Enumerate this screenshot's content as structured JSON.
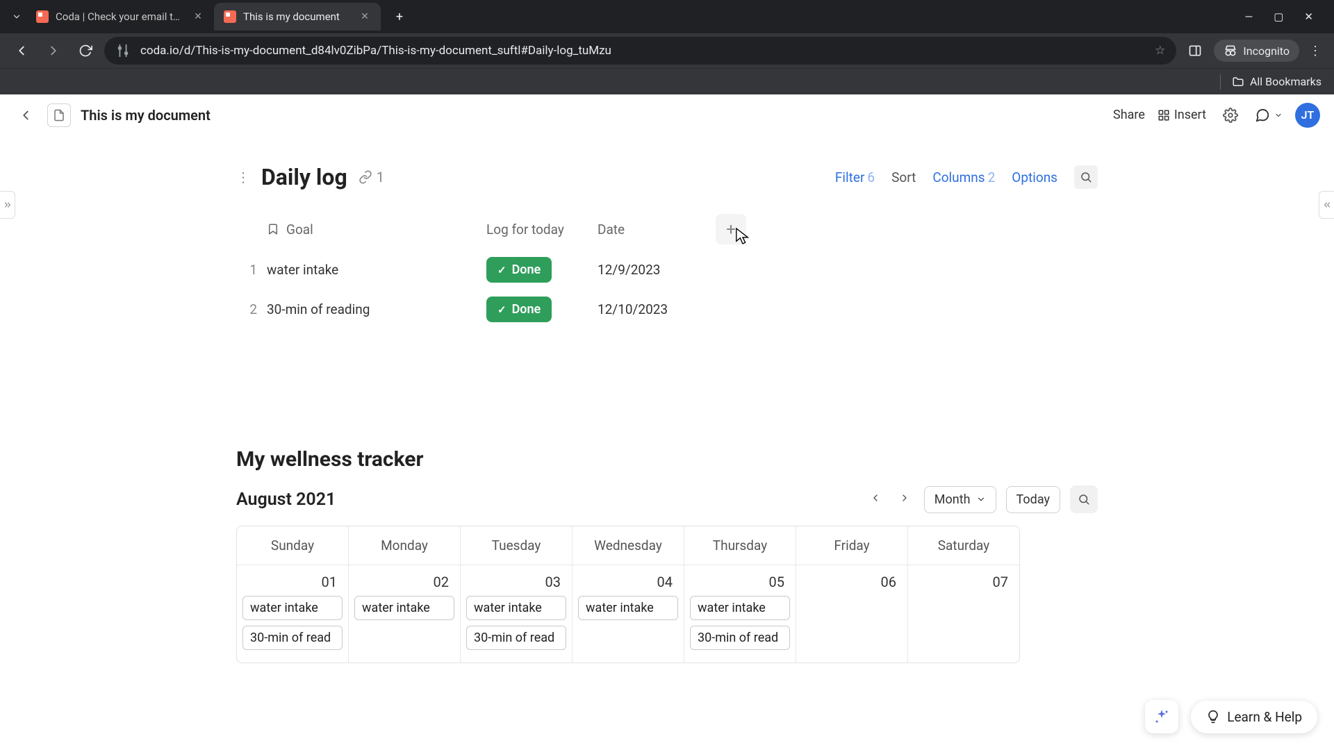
{
  "browser": {
    "tabs": [
      {
        "title": "Coda | Check your email to fin"
      },
      {
        "title": "This is my document"
      }
    ],
    "url": "coda.io/d/This-is-my-document_d84lv0ZibPa/This-is-my-document_suftl#Daily-log_tuMzu",
    "incognito_label": "Incognito",
    "bookmarks_label": "All Bookmarks"
  },
  "header": {
    "doc_title": "This is my document",
    "share": "Share",
    "insert": "Insert",
    "avatar_initials": "JT"
  },
  "dailylog": {
    "title": "Daily log",
    "link_count": "1",
    "controls": {
      "filter_label": "Filter",
      "filter_count": "6",
      "sort_label": "Sort",
      "columns_label": "Columns",
      "columns_count": "2",
      "options_label": "Options"
    },
    "cols": {
      "goal": "Goal",
      "log": "Log for today",
      "date": "Date"
    },
    "rows": [
      {
        "n": "1",
        "goal": "water intake",
        "log": "Done",
        "date": "12/9/2023"
      },
      {
        "n": "2",
        "goal": "30-min of reading",
        "log": "Done",
        "date": "12/10/2023"
      }
    ]
  },
  "calendar": {
    "title": "My wellness tracker",
    "month_label": "August 2021",
    "view_label": "Month",
    "today_label": "Today",
    "weekdays": [
      "Sunday",
      "Monday",
      "Tuesday",
      "Wednesday",
      "Thursday",
      "Friday",
      "Saturday"
    ],
    "days": [
      {
        "num": "01",
        "events": [
          "water intake",
          "30-min of read"
        ]
      },
      {
        "num": "02",
        "events": [
          "water intake"
        ]
      },
      {
        "num": "03",
        "events": [
          "water intake",
          "30-min of read"
        ]
      },
      {
        "num": "04",
        "events": [
          "water intake"
        ]
      },
      {
        "num": "05",
        "events": [
          "water intake",
          "30-min of read"
        ]
      },
      {
        "num": "06",
        "events": []
      },
      {
        "num": "07",
        "events": []
      }
    ]
  },
  "float": {
    "learn_label": "Learn & Help"
  }
}
